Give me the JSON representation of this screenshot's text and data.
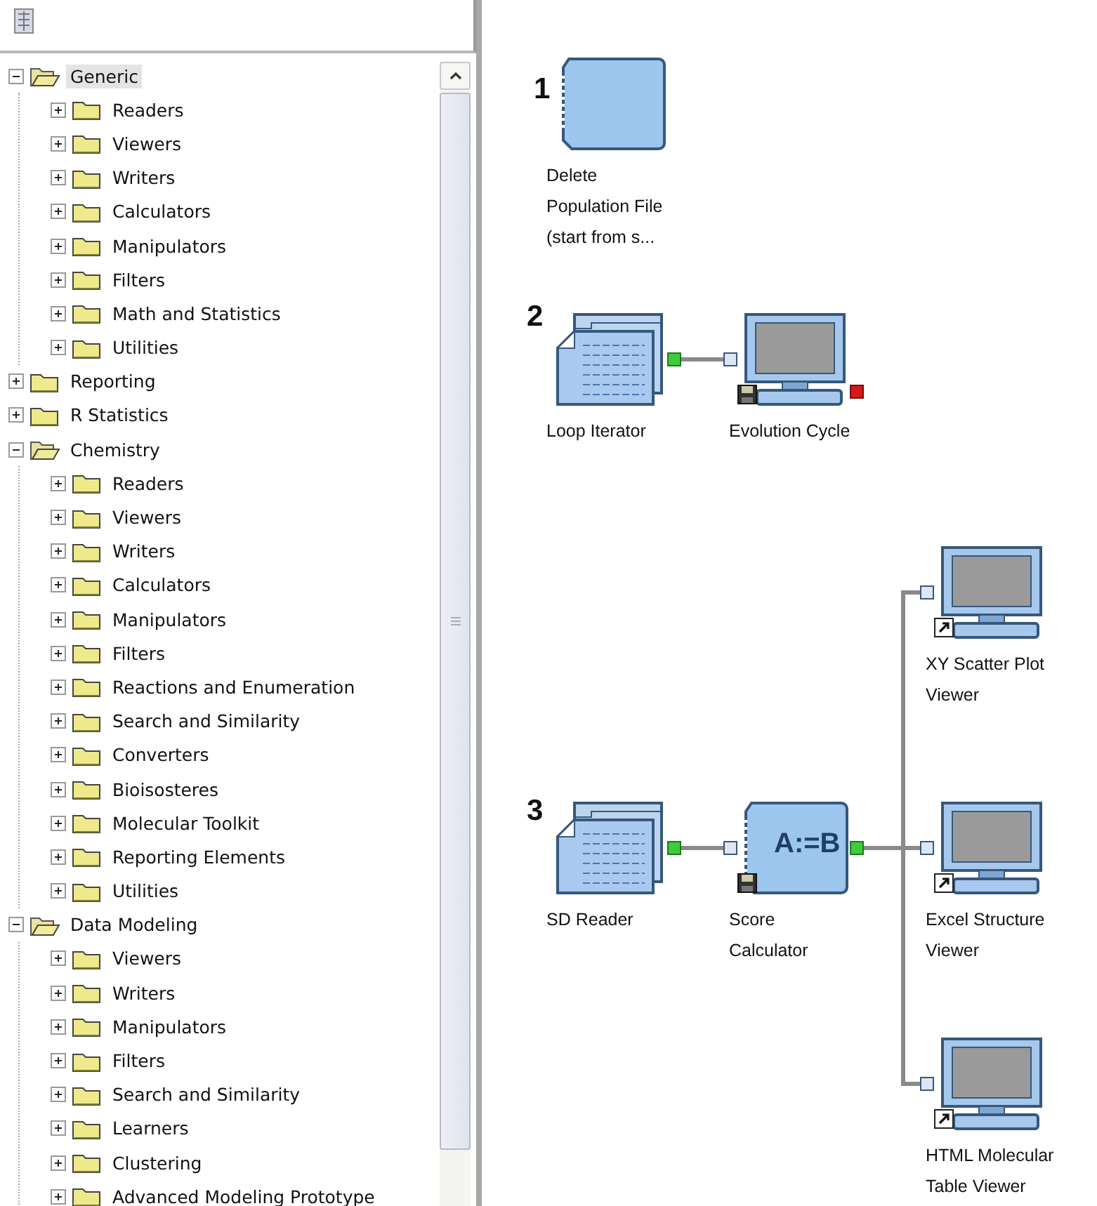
{
  "tree": [
    {
      "label": "Generic",
      "expanded": true,
      "selected": true,
      "children": [
        {
          "label": "Readers",
          "expanded": false,
          "selected": false
        },
        {
          "label": "Viewers",
          "expanded": false,
          "selected": false
        },
        {
          "label": "Writers",
          "expanded": false,
          "selected": false
        },
        {
          "label": "Calculators",
          "expanded": false,
          "selected": false
        },
        {
          "label": "Manipulators",
          "expanded": false,
          "selected": false
        },
        {
          "label": "Filters",
          "expanded": false,
          "selected": false
        },
        {
          "label": "Math and Statistics",
          "expanded": false,
          "selected": false
        },
        {
          "label": "Utilities",
          "expanded": false,
          "selected": false
        }
      ]
    },
    {
      "label": "Reporting",
      "expanded": false,
      "selected": false
    },
    {
      "label": "R Statistics",
      "expanded": false,
      "selected": false
    },
    {
      "label": "Chemistry",
      "expanded": true,
      "selected": false,
      "children": [
        {
          "label": "Readers",
          "expanded": false,
          "selected": false
        },
        {
          "label": "Viewers",
          "expanded": false,
          "selected": false
        },
        {
          "label": "Writers",
          "expanded": false,
          "selected": false
        },
        {
          "label": "Calculators",
          "expanded": false,
          "selected": false
        },
        {
          "label": "Manipulators",
          "expanded": false,
          "selected": false
        },
        {
          "label": "Filters",
          "expanded": false,
          "selected": false
        },
        {
          "label": "Reactions and Enumeration",
          "expanded": false,
          "selected": false
        },
        {
          "label": "Search and Similarity",
          "expanded": false,
          "selected": false
        },
        {
          "label": "Converters",
          "expanded": false,
          "selected": false
        },
        {
          "label": "Bioisosteres",
          "expanded": false,
          "selected": false
        },
        {
          "label": "Molecular Toolkit",
          "expanded": false,
          "selected": false
        },
        {
          "label": "Reporting Elements",
          "expanded": false,
          "selected": false
        },
        {
          "label": "Utilities",
          "expanded": false,
          "selected": false
        }
      ]
    },
    {
      "label": "Data Modeling",
      "expanded": true,
      "selected": false,
      "children": [
        {
          "label": "Viewers",
          "expanded": false,
          "selected": false
        },
        {
          "label": "Writers",
          "expanded": false,
          "selected": false
        },
        {
          "label": "Manipulators",
          "expanded": false,
          "selected": false
        },
        {
          "label": "Filters",
          "expanded": false,
          "selected": false
        },
        {
          "label": "Search and Similarity",
          "expanded": false,
          "selected": false
        },
        {
          "label": "Learners",
          "expanded": false,
          "selected": false
        },
        {
          "label": "Clustering",
          "expanded": false,
          "selected": false
        },
        {
          "label": "Advanced Modeling Prototype",
          "expanded": false,
          "selected": false
        }
      ]
    }
  ],
  "pipelines": [
    {
      "number": "1",
      "nodes": [
        {
          "kind": "component",
          "label_lines": [
            "Delete",
            "Population File",
            "(start from s..."
          ]
        }
      ]
    },
    {
      "number": "2",
      "nodes": [
        {
          "kind": "reader",
          "label_lines": [
            "Loop Iterator"
          ],
          "output_port": true,
          "outputs": [
            {
              "kind": "viewer",
              "label_lines": [
                "Evolution Cycle"
              ],
              "error": true,
              "saved": true
            }
          ]
        }
      ]
    },
    {
      "number": "3",
      "nodes": [
        {
          "kind": "reader",
          "label_lines": [
            "SD Reader"
          ],
          "output_port": true,
          "outputs": [
            {
              "kind": "calculator",
              "icon_text": "A:=B",
              "label_lines": [
                "Score",
                "Calculator"
              ],
              "output_port": true,
              "saved": true,
              "outputs": [
                {
                  "kind": "viewer",
                  "label_lines": [
                    "XY Scatter Plot",
                    "Viewer"
                  ],
                  "shortcut": true
                },
                {
                  "kind": "viewer",
                  "label_lines": [
                    "Excel Structure",
                    "Viewer"
                  ],
                  "shortcut": true
                },
                {
                  "kind": "viewer",
                  "label_lines": [
                    "HTML Molecular",
                    "Table Viewer"
                  ],
                  "shortcut": true
                }
              ]
            }
          ]
        }
      ]
    }
  ]
}
